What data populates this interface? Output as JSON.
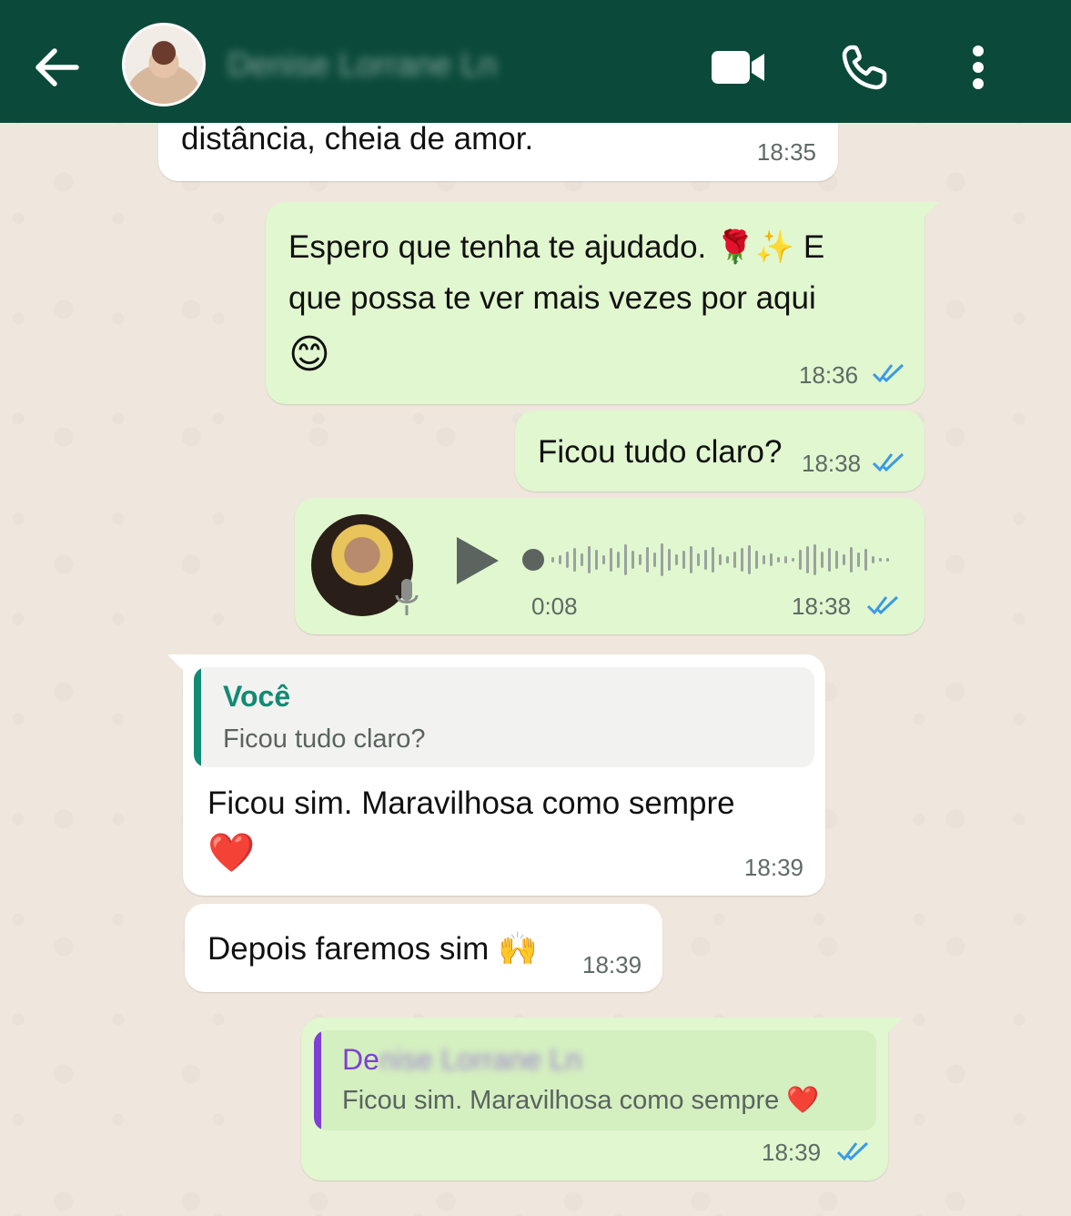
{
  "header": {
    "back_icon": "arrow-left-icon",
    "contact_name": "Denise Lorrane Ln",
    "video_icon": "video-camera-icon",
    "call_icon": "phone-icon",
    "menu_icon": "more-vertical-icon",
    "bg_color": "#0b4a3a"
  },
  "messages": {
    "m1": {
      "text": "distância, cheia de amor.",
      "time": "18:35",
      "direction": "incoming"
    },
    "m2": {
      "line1": "Espero que tenha te ajudado. 🌹✨ E",
      "line2": "que possa te ver mais vezes por aqui",
      "line3": "😊",
      "time": "18:36",
      "direction": "outgoing",
      "status": "read"
    },
    "m3": {
      "text": "Ficou tudo claro?",
      "time": "18:38",
      "direction": "outgoing",
      "status": "read"
    },
    "m4": {
      "type": "voice",
      "duration": "0:08",
      "time": "18:38",
      "direction": "outgoing",
      "status": "read"
    },
    "m5": {
      "quote_author": "Você",
      "quote_text": "Ficou tudo claro?",
      "line1": "Ficou sim. Maravilhosa como sempre",
      "line2": "❤️",
      "time": "18:39",
      "direction": "incoming"
    },
    "m6": {
      "text": "Depois faremos sim 🙌",
      "time": "18:39",
      "direction": "incoming"
    },
    "m7": {
      "quote_author": "Denise Lorrane Ln",
      "quote_author_visible": "De",
      "quote_text": "Ficou sim. Maravilhosa como sempre ❤️",
      "time": "18:39",
      "direction": "outgoing",
      "status": "read"
    }
  },
  "colors": {
    "incoming_bubble": "#ffffff",
    "outgoing_bubble": "#e1f7cf",
    "read_ticks": "#3b9ae8",
    "you_quote": "#138a74",
    "contact_quote": "#7e3fd6"
  }
}
